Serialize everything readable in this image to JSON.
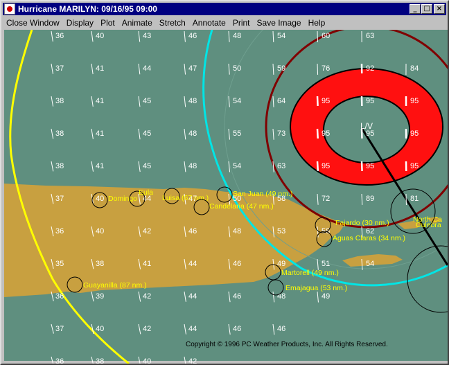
{
  "window": {
    "title": "Hurricane MARILYN: 09/16/95 09:00",
    "controls": [
      "_",
      "□",
      "×"
    ]
  },
  "menu": [
    {
      "label": "Close Window",
      "accel": "C"
    },
    {
      "label": "Display",
      "accel": "D"
    },
    {
      "label": "Plot",
      "accel": "P"
    },
    {
      "label": "Animate",
      "accel": "A"
    },
    {
      "label": "Stretch",
      "accel": "S"
    },
    {
      "label": "Annotate",
      "accel": "A"
    },
    {
      "label": "Print",
      "accel": "r"
    },
    {
      "label": "Save Image",
      "accel": "S"
    },
    {
      "label": "Help",
      "accel": "H"
    }
  ],
  "map": {
    "copyright": "Copyright © 1996 PC Weather Products, Inc. All Rights Reserved.",
    "storm_center_label": "L/V",
    "colors": {
      "ocean": "#5f8f7f",
      "land": "#c8a040",
      "wind_ring": "#ff1010",
      "cone_yellow": "#ffff00",
      "radius_cyan": "#00e5e5",
      "radius_darkred": "#800000",
      "city_label": "#ffff00"
    },
    "cities": [
      {
        "name": "Domingo",
        "label": "Domingo"
      },
      {
        "name": "Eula",
        "label": "Eula"
      },
      {
        "name": "Luisa",
        "label": "Luisa (67 nm.)"
      },
      {
        "name": "San Juan",
        "label": "San Juan (49 nm.)"
      },
      {
        "name": "Candelaria",
        "label": "Candelaria (47 nm.)"
      },
      {
        "name": "Fajardo",
        "label": "Fajardo (30 nm.)"
      },
      {
        "name": "Aguas Claras",
        "label": "Aguas Claras (34 nm.)"
      },
      {
        "name": "Martorell",
        "label": "Martorell (49 nm.)"
      },
      {
        "name": "Emajagua",
        "label": "Emajagua (53 nm.)"
      },
      {
        "name": "Guayanilla",
        "label": "Guayanilla (87 nm.)"
      },
      {
        "name": "North Ca",
        "label": "North Ca"
      },
      {
        "name": "Culebra",
        "label": "Culebra"
      }
    ],
    "wind_values": [
      [
        36,
        40,
        43,
        46,
        48,
        54,
        60,
        63
      ],
      [
        37,
        41,
        44,
        47,
        50,
        59,
        76,
        92,
        84
      ],
      [
        38,
        41,
        45,
        48,
        54,
        64,
        95,
        95,
        95
      ],
      [
        38,
        41,
        45,
        48,
        55,
        73,
        95,
        95,
        95
      ],
      [
        38,
        41,
        45,
        48,
        54,
        63,
        95,
        95,
        95
      ],
      [
        37,
        40,
        44,
        47,
        50,
        58,
        72,
        89,
        81
      ],
      [
        36,
        40,
        42,
        46,
        48,
        53,
        58,
        62
      ],
      [
        35,
        38,
        41,
        44,
        46,
        49,
        51,
        54
      ],
      [
        36,
        39,
        42,
        44,
        46,
        48,
        49
      ],
      [
        37,
        40,
        42,
        44,
        46,
        46
      ],
      [
        36,
        38,
        40,
        42
      ]
    ]
  }
}
